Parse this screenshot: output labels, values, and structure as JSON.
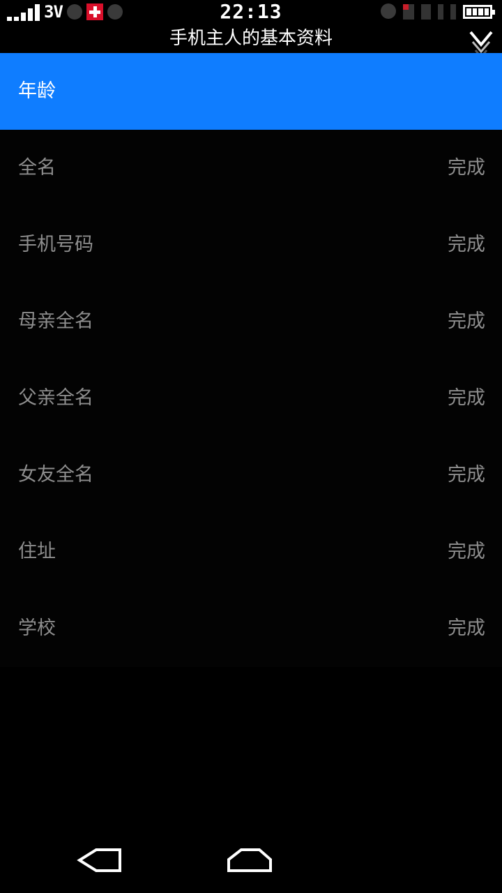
{
  "status_bar": {
    "network_type": "3V",
    "time": "22:13"
  },
  "header": {
    "title": "手机主人的基本资料"
  },
  "list": {
    "items": [
      {
        "label": "年龄",
        "status": "",
        "selected": true
      },
      {
        "label": "全名",
        "status": "完成"
      },
      {
        "label": "手机号码",
        "status": "完成"
      },
      {
        "label": "母亲全名",
        "status": "完成"
      },
      {
        "label": "父亲全名",
        "status": "完成"
      },
      {
        "label": "女友全名",
        "status": "完成"
      },
      {
        "label": "住址",
        "status": "完成"
      },
      {
        "label": "学校",
        "status": "完成"
      }
    ]
  },
  "colors": {
    "selected_row": "#0f7dff",
    "background": "#000000",
    "muted_text": "#8e8e8e"
  },
  "icons": {
    "collapse": "chevron-down-icon",
    "back": "back-icon",
    "home": "home-icon",
    "battery": "battery-icon",
    "signal": "signal-icon"
  }
}
